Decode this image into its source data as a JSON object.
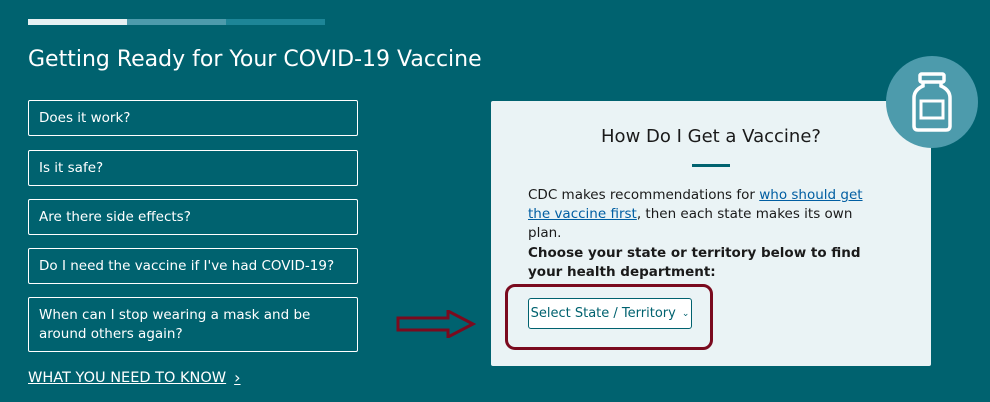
{
  "progress": {
    "segments": 3,
    "completed": 1,
    "colors": [
      "#e6f0f2",
      "#4d9bac",
      "#1d8597"
    ]
  },
  "page": {
    "title": "Getting Ready for Your COVID-19 Vaccine"
  },
  "faq": [
    {
      "label": "Does it work?"
    },
    {
      "label": "Is it safe?"
    },
    {
      "label": "Are there side effects?"
    },
    {
      "label": "Do I need the vaccine if I've had COVID-19?"
    },
    {
      "label": "When can I stop wearing a mask and be around others again?"
    }
  ],
  "know_link": {
    "label": "WHAT YOU NEED TO KNOW",
    "icon": "chevron-right-icon"
  },
  "card": {
    "title": "How Do I Get a Vaccine?",
    "text_before": "CDC makes recommendations for ",
    "link_text": "who should get the vaccine first",
    "text_after": ", then each state makes its own plan.",
    "label": "Choose your state or territory below to find your health department:",
    "select": {
      "value": "Select State / Territory",
      "icon": "chevron-down-icon"
    }
  },
  "badge": {
    "icon": "vaccine-vial-icon"
  },
  "annotation": {
    "arrow_icon": "arrow-right-icon",
    "highlight_color": "#7a0a1e"
  }
}
